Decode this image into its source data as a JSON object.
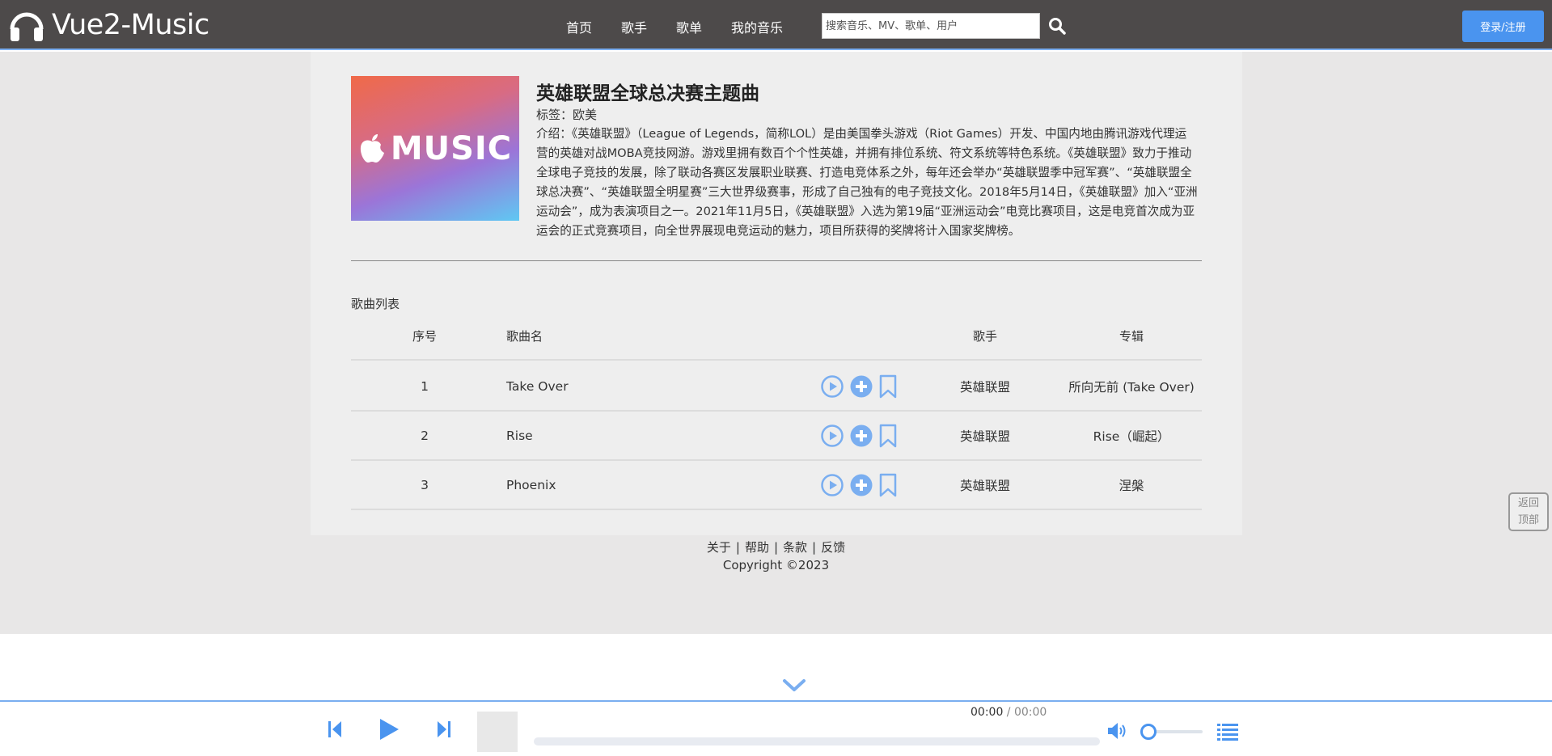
{
  "header": {
    "app_name": "Vue2-Music",
    "nav": [
      "首页",
      "歌手",
      "歌单",
      "我的音乐"
    ],
    "search_placeholder": "搜索音乐、MV、歌单、用户",
    "login_label": "登录/注册",
    "accent_color": "#4a94ef"
  },
  "album": {
    "cover_text": "MUSIC",
    "title": "英雄联盟全球总决赛主题曲",
    "tag": "标签：欧美",
    "description": "介绍：《英雄联盟》（League of Legends，简称LOL）是由美国拳头游戏（Riot Games）开发、中国内地由腾讯游戏代理运营的英雄对战MOBA竞技网游。游戏里拥有数百个个性英雄，并拥有排位系统、符文系统等特色系统。《英雄联盟》致力于推动全球电子竞技的发展，除了联动各赛区发展职业联赛、打造电竞体系之外，每年还会举办“英雄联盟季中冠军赛”、“英雄联盟全球总决赛”、“英雄联盟全明星赛”三大世界级赛事，形成了自己独有的电子竞技文化。2018年5月14日，《英雄联盟》加入“亚洲运动会”，成为表演项目之一。2021年11月5日，《英雄联盟》入选为第19届“亚洲运动会”电竞比赛项目，这是电竞首次成为亚运会的正式竞赛项目，向全世界展现电竞运动的魅力，项目所获得的奖牌将计入国家奖牌榜。"
  },
  "song_list": {
    "title": "歌曲列表",
    "headers": {
      "no": "序号",
      "name": "歌曲名",
      "artist": "歌手",
      "album": "专辑"
    },
    "rows": [
      {
        "no": "1",
        "name": "Take Over",
        "artist": "英雄联盟",
        "album": "所向无前 (Take Over)"
      },
      {
        "no": "2",
        "name": "Rise",
        "artist": "英雄联盟",
        "album": "Rise（崛起）"
      },
      {
        "no": "3",
        "name": "Phoenix",
        "artist": "英雄联盟",
        "album": "涅槃"
      }
    ],
    "row_icons": [
      "play-circle-icon",
      "add-circle-icon",
      "bookmark-icon"
    ]
  },
  "footer": {
    "links": [
      "关于",
      "帮助",
      "条款",
      "反馈"
    ],
    "separator": "|",
    "copyright": "Copyright ©2023"
  },
  "back_to_top": {
    "line1": "返回",
    "line2": "顶部"
  },
  "player": {
    "current_time": "00:00",
    "separator": " / ",
    "duration": "00:00",
    "progress": 0,
    "volume": 0.1
  }
}
